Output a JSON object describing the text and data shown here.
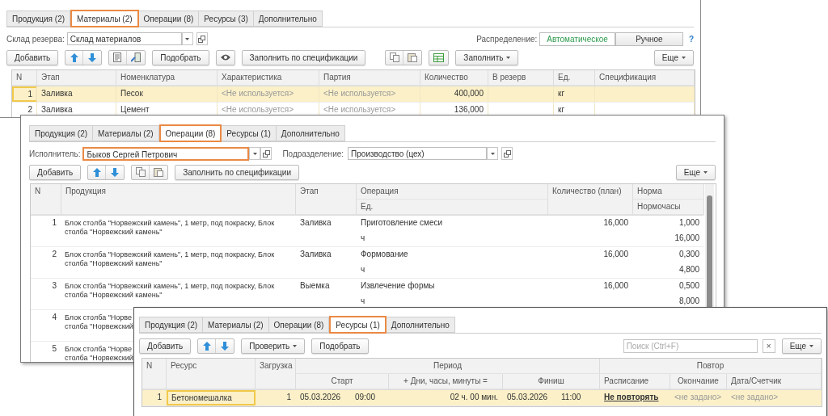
{
  "materials_window": {
    "tabs": [
      {
        "label": "Продукция (2)",
        "selected": false
      },
      {
        "label": "Материалы (2)",
        "selected": true
      },
      {
        "label": "Операции (8)",
        "selected": false
      },
      {
        "label": "Ресурсы (3)",
        "selected": false
      },
      {
        "label": "Дополнительно",
        "selected": false
      }
    ],
    "reserve_warehouse": {
      "label": "Склад резерва:",
      "value": "Склад материалов"
    },
    "distribution": {
      "label": "Распределение:",
      "options": [
        {
          "label": "Автоматическое",
          "selected": true
        },
        {
          "label": "Ручное",
          "selected": false
        }
      ],
      "help": "?"
    },
    "toolbar": {
      "add": "Добавить",
      "pick": "Подобрать",
      "fill_spec": "Заполнить по спецификации",
      "fill": "Заполнить",
      "more": "Еще"
    },
    "table": {
      "columns": [
        "N",
        "Этап",
        "Номенклатура",
        "Характеристика",
        "Партия",
        "Количество",
        "В резерв",
        "Ед.",
        "Спецификация"
      ],
      "rows": [
        {
          "n": "1",
          "stage": "Заливка",
          "item": "Песок",
          "characteristic": "<Не используется>",
          "batch": "<Не используется>",
          "quantity": "400,000",
          "unit": "кг",
          "selected": true
        },
        {
          "n": "2",
          "stage": "Заливка",
          "item": "Цемент",
          "characteristic": "<Не используется>",
          "batch": "<Не используется>",
          "quantity": "136,000",
          "unit": "кг",
          "selected": false
        }
      ]
    }
  },
  "operations_window": {
    "tabs": [
      {
        "label": "Продукция (2)",
        "selected": false
      },
      {
        "label": "Материалы (2)",
        "selected": false
      },
      {
        "label": "Операции (8)",
        "selected": true
      },
      {
        "label": "Ресурсы (1)",
        "selected": false
      },
      {
        "label": "Дополнительно",
        "selected": false
      }
    ],
    "executor": {
      "label": "Исполнитель:",
      "value": "Быков Сергей Петрович",
      "highlighted": true
    },
    "department": {
      "label": "Подразделение:",
      "value": "Производство (цех)",
      "highlighted": false
    },
    "toolbar": {
      "add": "Добавить",
      "fill_spec": "Заполнить по спецификации",
      "more": "Еще"
    },
    "table": {
      "columns": {
        "n": "N",
        "product": "Продукция",
        "stage": "Этап",
        "operation": "Операция",
        "unit": "Ед.",
        "quantity": "Количество (план)",
        "norm": "Норма",
        "norm_hours": "Нормочасы"
      },
      "rows": [
        {
          "n": "1",
          "product": [
            "Блок столба \"Норвежский камень\", 1 метр, под покраску, Блок",
            "столба \"Норвежский камень\""
          ],
          "stage": "Заливка",
          "operation": "Приготовление смеси",
          "unit": "ч",
          "quantity": "16,000",
          "norm": "1,000",
          "norm_hours": "16,000"
        },
        {
          "n": "2",
          "product": [
            "Блок столба \"Норвежский камень\", 1 метр, под покраску, Блок",
            "столба \"Норвежский камень\""
          ],
          "stage": "Заливка",
          "operation": "Формование",
          "unit": "ч",
          "quantity": "16,000",
          "norm": "0,300",
          "norm_hours": "4,800"
        },
        {
          "n": "3",
          "product": [
            "Блок столба \"Норвежский камень\", 1 метр, под покраску, Блок",
            "столба \"Норвежский камень\""
          ],
          "stage": "Выемка",
          "operation": "Извлечение формы",
          "unit": "ч",
          "quantity": "16,000",
          "norm": "0,500",
          "norm_hours": "8,000"
        },
        {
          "n": "4",
          "product": [
            "Блок столба \"Норве",
            "столба \"Норвежский"
          ]
        },
        {
          "n": "5",
          "product": [
            "Блок столба \"Норве",
            "столба \"Норвежский"
          ]
        }
      ]
    }
  },
  "resources_window": {
    "tabs": [
      {
        "label": "Продукция (2)",
        "selected": false
      },
      {
        "label": "Материалы (2)",
        "selected": false
      },
      {
        "label": "Операции (8)",
        "selected": false
      },
      {
        "label": "Ресурсы (1)",
        "selected": true
      },
      {
        "label": "Дополнительно",
        "selected": false
      }
    ],
    "toolbar": {
      "add": "Добавить",
      "check": "Проверить",
      "pick": "Подобрать",
      "search_placeholder": "Поиск (Ctrl+F)",
      "clear": "×",
      "more": "Еще"
    },
    "table": {
      "columns": {
        "n": "N",
        "resource": "Ресурс",
        "load": "Загрузка",
        "period": "Период",
        "start": "Старт",
        "duration": "+ Дни, часы, минуты =",
        "finish": "Финиш",
        "repeat": "Повтор",
        "schedule": "Расписание",
        "end": "Окончание",
        "date_counter": "Дата/Счетчик"
      },
      "rows": [
        {
          "n": "1",
          "resource": "Бетономешалка",
          "load": "1",
          "start_date": "05.03.2026",
          "start_time": "09:00",
          "duration": "02 ч. 00 мин.",
          "finish_date": "05.03.2026",
          "finish_time": "11:00",
          "schedule": "Не повторять",
          "end": "<не задано>",
          "date_counter": "<не задано>",
          "selected": true
        }
      ]
    }
  }
}
